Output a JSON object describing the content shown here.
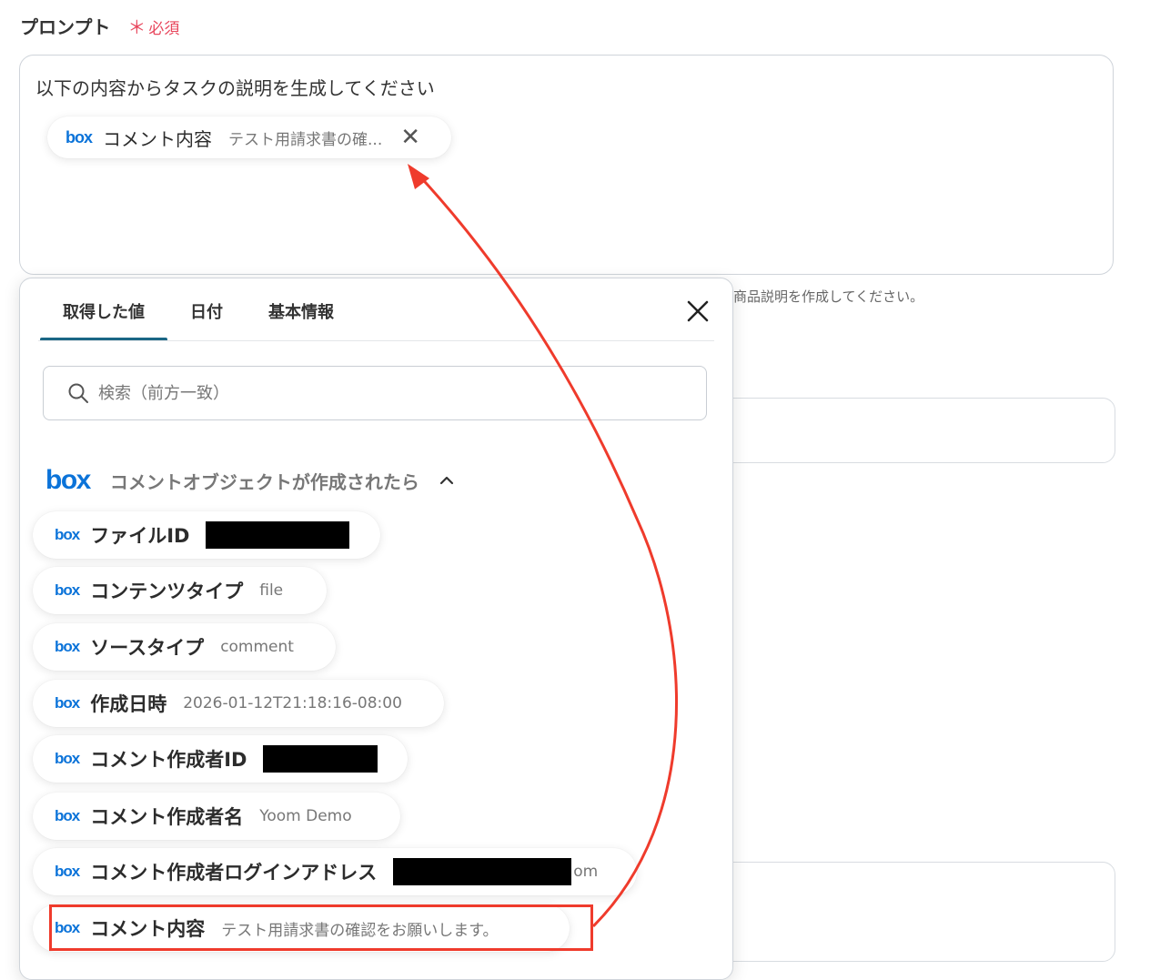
{
  "field": {
    "label": "プロンプト",
    "required_star": "＊",
    "required_text": "必須"
  },
  "prompt": {
    "text": "以下の内容からタスクの説明を生成してください",
    "chip": {
      "logo": "box",
      "label": "コメント内容",
      "value": "テスト用請求書の確..."
    }
  },
  "background": {
    "hint": "商品説明を作成してください。"
  },
  "panel": {
    "tabs": [
      "取得した値",
      "日付",
      "基本情報"
    ],
    "search_placeholder": "検索（前方一致）",
    "group": {
      "logo": "box",
      "title": "コメントオブジェクトが作成されたら"
    },
    "items": [
      {
        "logo": "box",
        "label": "ファイルID",
        "value": ""
      },
      {
        "logo": "box",
        "label": "コンテンツタイプ",
        "value": "file"
      },
      {
        "logo": "box",
        "label": "ソースタイプ",
        "value": "comment"
      },
      {
        "logo": "box",
        "label": "作成日時",
        "value": "2026-01-12T21:18:16-08:00"
      },
      {
        "logo": "box",
        "label": "コメント作成者ID",
        "value": ""
      },
      {
        "logo": "box",
        "label": "コメント作成者名",
        "value": "Yoom Demo"
      },
      {
        "logo": "box",
        "label": "コメント作成者ログインアドレス",
        "value": "om"
      },
      {
        "logo": "box",
        "label": "コメント内容",
        "value": "テスト用請求書の確認をお願いします。"
      }
    ]
  },
  "colors": {
    "accent": "#1a6685",
    "box_blue": "#0b73d9",
    "required": "#e8475d",
    "annotation": "#ef3b2c"
  }
}
